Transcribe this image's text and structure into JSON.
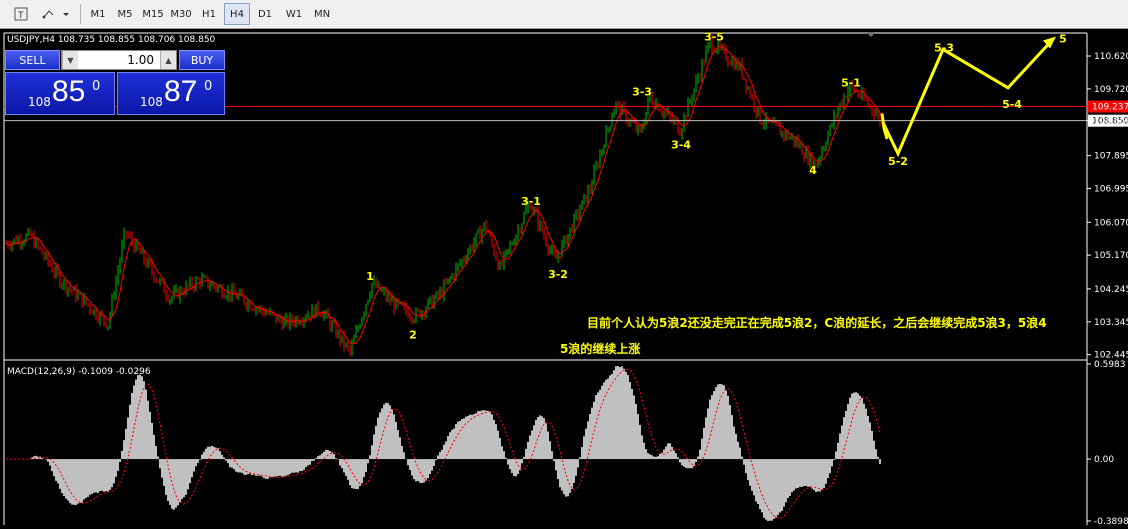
{
  "toolbar": {
    "periods": [
      "M1",
      "M5",
      "M15",
      "M30",
      "H1",
      "H4",
      "D1",
      "W1",
      "MN"
    ],
    "active_period": "H4"
  },
  "trade_panel": {
    "sell_label": "SELL",
    "buy_label": "BUY",
    "lot": "1.00",
    "sell_price_small": "108",
    "sell_price_big": "85",
    "sell_price_sup": "0",
    "buy_price_small": "108",
    "buy_price_big": "87",
    "buy_price_sup": "0"
  },
  "chart_data": {
    "type": "candlestick",
    "symbol_info": "USDJPY,H4  108.735 108.855 108.706 108.850",
    "y_ticks": [
      "110.620",
      "109.720",
      "108.850",
      "107.895",
      "106.995",
      "106.070",
      "105.170",
      "104.245",
      "103.345",
      "102.445"
    ],
    "y_tick_values": [
      110.62,
      109.72,
      108.85,
      107.895,
      106.995,
      106.07,
      105.17,
      104.245,
      103.345,
      102.445
    ],
    "ylim": [
      102.3,
      111.25
    ],
    "current_price": "108.850",
    "red_line_price": "109.237",
    "wave_labels": [
      {
        "text": "1",
        "price": 104.6
      },
      {
        "text": "2",
        "price": 103.0
      },
      {
        "text": "3-1",
        "price": 106.65
      },
      {
        "text": "3-2",
        "price": 104.65
      },
      {
        "text": "3-3",
        "price": 109.65
      },
      {
        "text": "3-4",
        "price": 108.2
      },
      {
        "text": "3-5",
        "price": 111.15
      },
      {
        "text": "4",
        "price": 107.5
      },
      {
        "text": "5-1",
        "price": 109.9
      },
      {
        "text": "5-2",
        "price": 107.75
      },
      {
        "text": "5-3",
        "price": 110.85
      },
      {
        "text": "5-4",
        "price": 109.3
      },
      {
        "text": "5",
        "price": 111.1
      }
    ],
    "projection": [
      109.05,
      108.65,
      108.35,
      108.8,
      107.95,
      110.8,
      109.75,
      111.05
    ],
    "annotation_line1": "目前个人认为5浪2还没走完正在完成5浪2，C浪的延长，之后会继续完成5浪3，5浪4",
    "annotation_line2": "5浪的继续上涨",
    "colors": {
      "bull": "#00c000",
      "bear": "#ff0000",
      "ma": "#ff0000",
      "wave_label": "#ffff00",
      "projection": "#ffff00",
      "macd_hist": "#c0c0c0",
      "macd_signal": "#ff0000"
    },
    "macd": {
      "label": "MACD(12,26,9) -0.1009 -0.0296",
      "y_ticks": [
        "0.5983",
        "0.00",
        "-0.3898"
      ],
      "ylim": [
        -0.3898,
        0.5983
      ]
    }
  }
}
